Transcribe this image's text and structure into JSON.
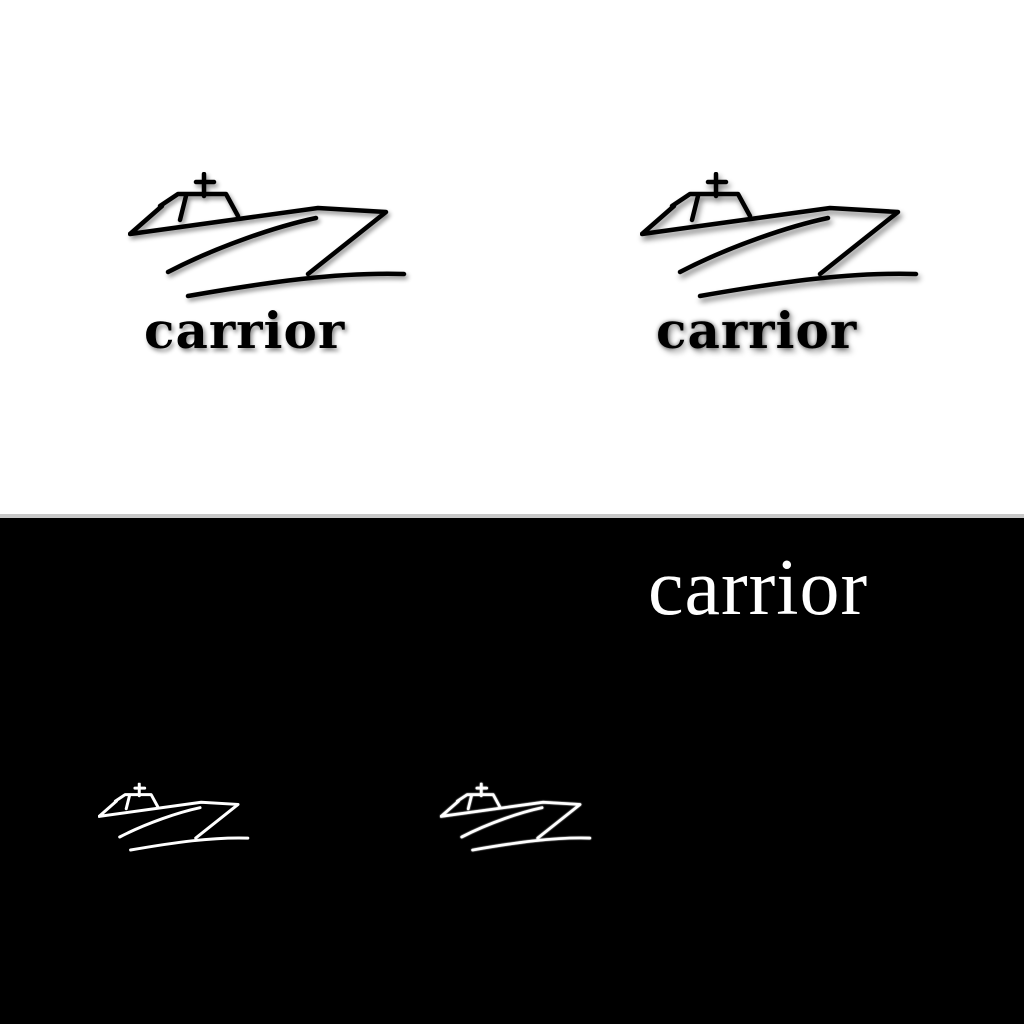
{
  "brand": {
    "name": "carrior"
  },
  "variants": [
    {
      "id": "light-flat",
      "label": "carrior",
      "background": "#ffffff",
      "ink": "#000000"
    },
    {
      "id": "light-shadow",
      "label": "carrior",
      "background": "#ffffff",
      "ink": "#000000"
    },
    {
      "id": "dark-wordmark",
      "label": "carrior",
      "background": "#000000",
      "ink": "#ffffff"
    },
    {
      "id": "dark-mark-flat",
      "background": "#000000",
      "ink": "#ffffff"
    },
    {
      "id": "dark-mark-glow",
      "background": "#000000",
      "ink": "#ffffff"
    }
  ],
  "colors": {
    "light_bg": "#ffffff",
    "dark_bg": "#000000",
    "divider": "#c8c8c8",
    "ink_dark": "#000000",
    "ink_light": "#ffffff"
  },
  "icon": "boat-icon"
}
